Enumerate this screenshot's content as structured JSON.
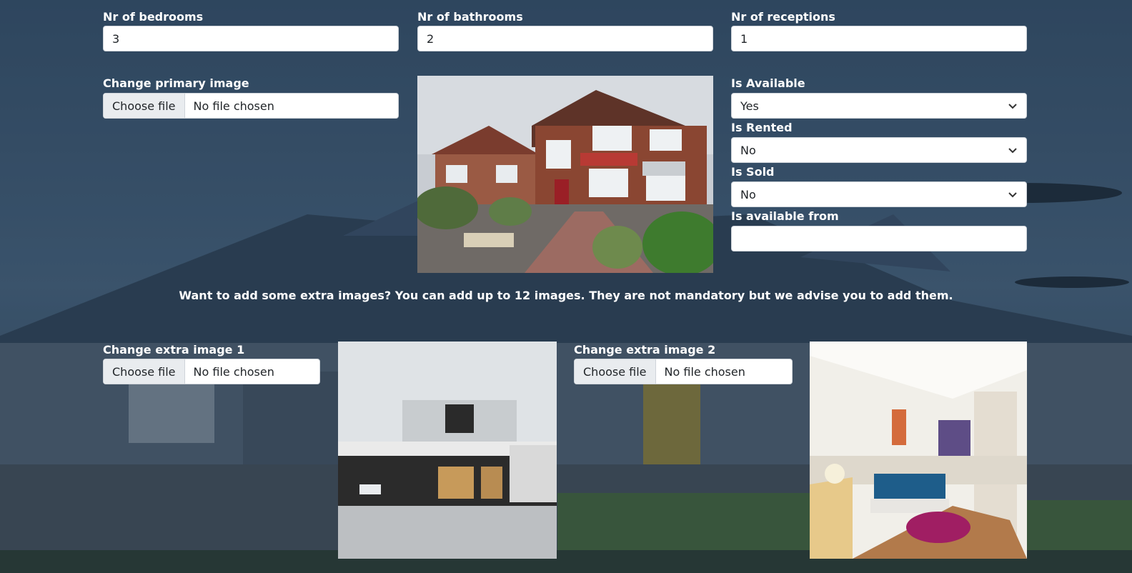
{
  "fields": {
    "bedrooms": {
      "label": "Nr of bedrooms",
      "value": "3"
    },
    "bathrooms": {
      "label": "Nr of bathrooms",
      "value": "2"
    },
    "receptions": {
      "label": "Nr of receptions",
      "value": "1"
    }
  },
  "primary_image": {
    "label": "Change primary image",
    "button": "Choose file",
    "status": "No file chosen"
  },
  "status": {
    "available": {
      "label": "Is Available",
      "value": "Yes"
    },
    "rented": {
      "label": "Is Rented",
      "value": "No"
    },
    "sold": {
      "label": "Is Sold",
      "value": "No"
    },
    "available_from": {
      "label": "Is available from",
      "value": ""
    }
  },
  "extra_note": "Want to add some extra images? You can add up to 12 images. They are not mandatory but we advise you to add them.",
  "extra_images": [
    {
      "label": "Change extra image 1",
      "button": "Choose file",
      "status": "No file chosen"
    },
    {
      "label": "Change extra image 2",
      "button": "Choose file",
      "status": "No file chosen"
    }
  ],
  "icons": {
    "select_arrow": "chevron-down-icon"
  }
}
